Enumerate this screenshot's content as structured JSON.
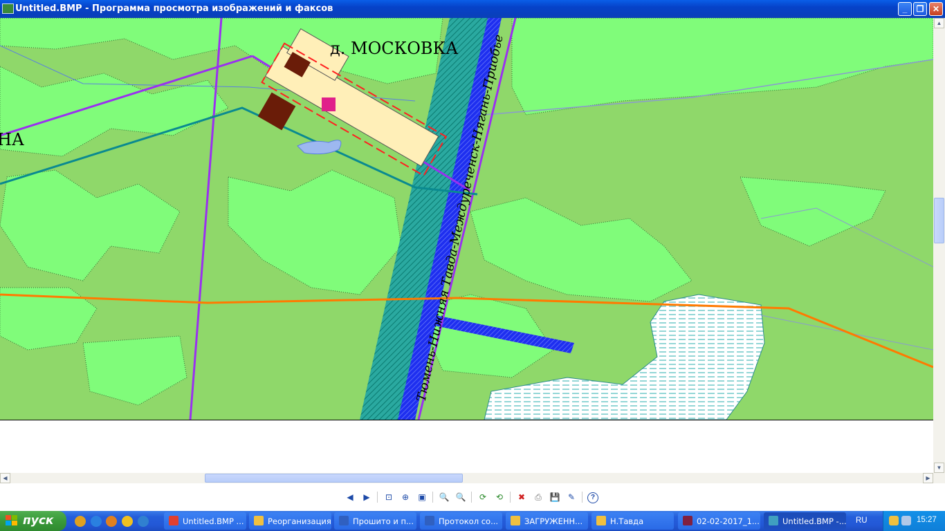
{
  "window": {
    "title": "Untitled.BMP - Программа просмотра изображений и факсов",
    "buttons": {
      "minimize": "_",
      "restore": "❐",
      "close": "✕"
    }
  },
  "map": {
    "settlement_label": "д. МОСКОВКА",
    "left_edge_label": "НА",
    "road_label": "Тюмень-Нижняя Тавда-Междуреченск-Нягань-Приобье",
    "colors": {
      "forest": "#80fc7a",
      "field": "#8fd86a",
      "water": "#9db8f0",
      "road_hatch": "#1e2ff0",
      "corridor": "#2aa9a0",
      "pipeline": "#ff7a00",
      "power_line": "#9a30f0",
      "swamp": "#8fe0e0",
      "settlement_fill": "#ffefb8",
      "boundary": "#ff2020"
    }
  },
  "toolbar": {
    "prev": "◀",
    "next": "▶",
    "best_fit": "⊡",
    "actual_size": "⊕",
    "slideshow": "▣",
    "zoom_in": "🔍",
    "zoom_out": "🔍",
    "rotate_cw": "⟳",
    "rotate_ccw": "⟲",
    "delete": "✖",
    "print": "⎙",
    "save": "💾",
    "edit": "✎",
    "help": "?"
  },
  "taskbar": {
    "start_label": "пуск",
    "tasks": [
      {
        "label": "Untitled.BMP ...",
        "color": "#e04030"
      },
      {
        "label": "Реорганизация",
        "color": "#f0c040"
      },
      {
        "label": "Прошито и п...",
        "color": "#3060c0"
      },
      {
        "label": "Протокол со...",
        "color": "#3060c0"
      },
      {
        "label": "ЗАГРУЖЕНН...",
        "color": "#f0c040"
      },
      {
        "label": "Н.Тавда",
        "color": "#f0c040"
      },
      {
        "label": "02-02-2017_1...",
        "color": "#802040"
      },
      {
        "label": "Untitled.BMP -...",
        "color": "#40a0c0"
      }
    ],
    "language": "RU",
    "clock": "15:27"
  }
}
